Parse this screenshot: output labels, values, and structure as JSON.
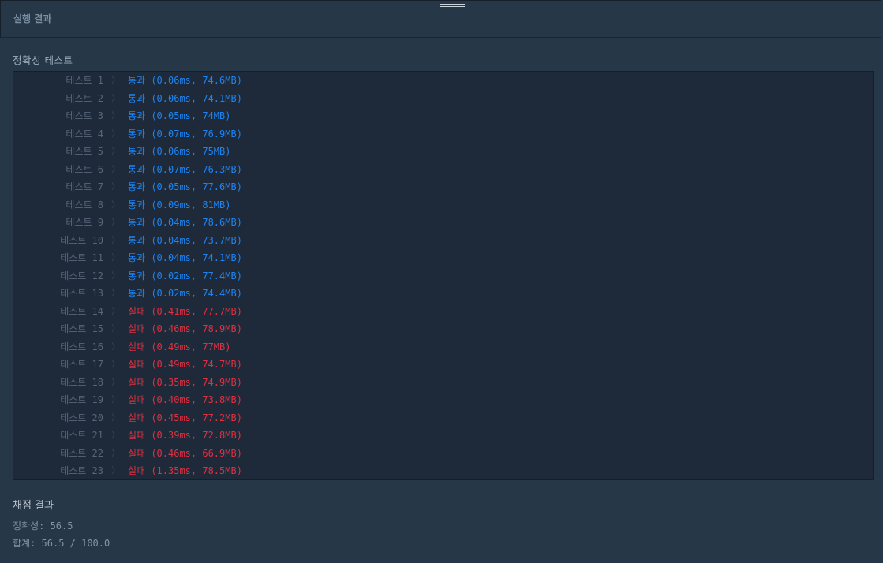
{
  "header": {
    "title": "실행 결과"
  },
  "accuracy_section": {
    "title": "정확성  테스트"
  },
  "tests": [
    {
      "label": "테스트 1",
      "status": "통과",
      "detail": "(0.06ms, 74.6MB)",
      "result": "pass"
    },
    {
      "label": "테스트 2",
      "status": "통과",
      "detail": "(0.06ms, 74.1MB)",
      "result": "pass"
    },
    {
      "label": "테스트 3",
      "status": "통과",
      "detail": "(0.05ms, 74MB)",
      "result": "pass"
    },
    {
      "label": "테스트 4",
      "status": "통과",
      "detail": "(0.07ms, 76.9MB)",
      "result": "pass"
    },
    {
      "label": "테스트 5",
      "status": "통과",
      "detail": "(0.06ms, 75MB)",
      "result": "pass"
    },
    {
      "label": "테스트 6",
      "status": "통과",
      "detail": "(0.07ms, 76.3MB)",
      "result": "pass"
    },
    {
      "label": "테스트 7",
      "status": "통과",
      "detail": "(0.05ms, 77.6MB)",
      "result": "pass"
    },
    {
      "label": "테스트 8",
      "status": "통과",
      "detail": "(0.09ms, 81MB)",
      "result": "pass"
    },
    {
      "label": "테스트 9",
      "status": "통과",
      "detail": "(0.04ms, 78.6MB)",
      "result": "pass"
    },
    {
      "label": "테스트 10",
      "status": "통과",
      "detail": "(0.04ms, 73.7MB)",
      "result": "pass"
    },
    {
      "label": "테스트 11",
      "status": "통과",
      "detail": "(0.04ms, 74.1MB)",
      "result": "pass"
    },
    {
      "label": "테스트 12",
      "status": "통과",
      "detail": "(0.02ms, 77.4MB)",
      "result": "pass"
    },
    {
      "label": "테스트 13",
      "status": "통과",
      "detail": "(0.02ms, 74.4MB)",
      "result": "pass"
    },
    {
      "label": "테스트 14",
      "status": "실패",
      "detail": "(0.41ms, 77.7MB)",
      "result": "fail"
    },
    {
      "label": "테스트 15",
      "status": "실패",
      "detail": "(0.46ms, 78.9MB)",
      "result": "fail"
    },
    {
      "label": "테스트 16",
      "status": "실패",
      "detail": "(0.49ms, 77MB)",
      "result": "fail"
    },
    {
      "label": "테스트 17",
      "status": "실패",
      "detail": "(0.49ms, 74.7MB)",
      "result": "fail"
    },
    {
      "label": "테스트 18",
      "status": "실패",
      "detail": "(0.35ms, 74.9MB)",
      "result": "fail"
    },
    {
      "label": "테스트 19",
      "status": "실패",
      "detail": "(0.40ms, 73.8MB)",
      "result": "fail"
    },
    {
      "label": "테스트 20",
      "status": "실패",
      "detail": "(0.45ms, 77.2MB)",
      "result": "fail"
    },
    {
      "label": "테스트 21",
      "status": "실패",
      "detail": "(0.39ms, 72.8MB)",
      "result": "fail"
    },
    {
      "label": "테스트 22",
      "status": "실패",
      "detail": "(0.46ms, 66.9MB)",
      "result": "fail"
    },
    {
      "label": "테스트 23",
      "status": "실패",
      "detail": "(1.35ms, 78.5MB)",
      "result": "fail"
    }
  ],
  "scoring": {
    "title": "채점 결과",
    "accuracy_line": "정확성: 56.5",
    "total_line": "합계: 56.5 / 100.0"
  },
  "colors": {
    "background": "#263747",
    "panel": "#1e2a3a",
    "pass": "#1d84f2",
    "fail": "#e2303f"
  },
  "icons": {
    "row_chevron": "chevron-right-icon",
    "drag_handle": "drag-handle-icon"
  }
}
